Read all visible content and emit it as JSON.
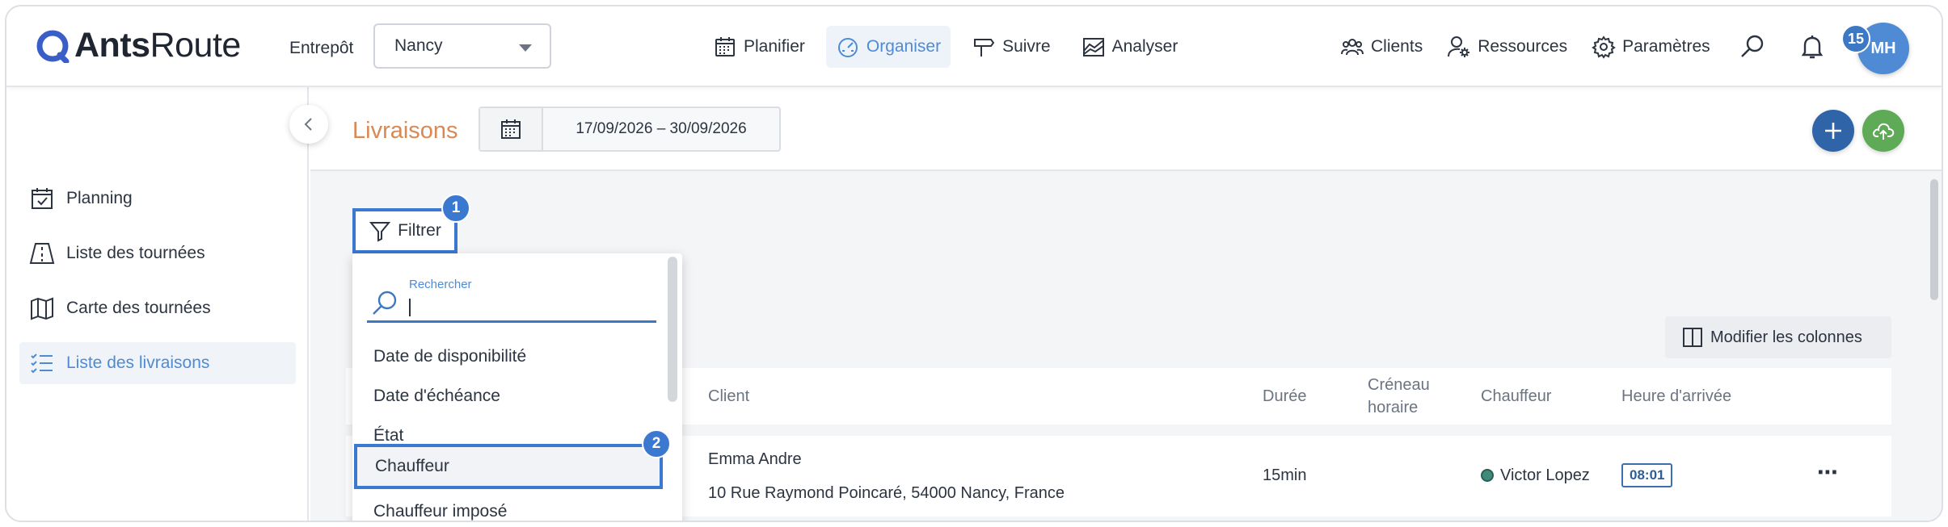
{
  "app": {
    "logo_bold": "Ants",
    "logo_light": "Route"
  },
  "topbar": {
    "entrepot_label": "Entrepôt",
    "entrepot_value": "Nancy",
    "nav": [
      {
        "label": "Planifier",
        "icon": "calendar-icon"
      },
      {
        "label": "Organiser",
        "icon": "gauge-icon",
        "active": true
      },
      {
        "label": "Suivre",
        "icon": "signpost-icon"
      },
      {
        "label": "Analyser",
        "icon": "area-chart-icon"
      }
    ],
    "right_nav": [
      {
        "label": "Clients",
        "icon": "people-icon"
      },
      {
        "label": "Ressources",
        "icon": "person-gear-icon"
      },
      {
        "label": "Paramètres",
        "icon": "gear-icon"
      }
    ],
    "notifications_count": "15",
    "avatar_initials": "MH"
  },
  "sidebar": {
    "items": [
      {
        "label": "Planning",
        "icon": "calendar-check-icon"
      },
      {
        "label": "Liste des tournées",
        "icon": "road-icon"
      },
      {
        "label": "Carte des tournées",
        "icon": "map-icon"
      },
      {
        "label": "Liste des livraisons",
        "icon": "list-check-icon",
        "active": true
      }
    ]
  },
  "header": {
    "title": "Livraisons",
    "date_range": "17/09/2026 – 30/09/2026"
  },
  "filter": {
    "button_label": "Filtrer",
    "step1": "1",
    "step2": "2",
    "search_label": "Rechercher",
    "options": [
      "Date de disponibilité",
      "Date d'échéance",
      "État",
      "Chauffeur",
      "Chauffeur imposé"
    ],
    "highlighted_option": "Chauffeur"
  },
  "table": {
    "modify_columns_label": "Modifier les colonnes",
    "columns": {
      "client": "Client",
      "duree": "Durée",
      "creneau": "Créneau horaire",
      "chauffeur": "Chauffeur",
      "arrivee": "Heure d'arrivée"
    },
    "rows": [
      {
        "client_name": "Emma Andre",
        "address": "10 Rue Raymond Poincaré, 54000 Nancy, France",
        "duree": "15min",
        "creneau": "",
        "chauffeur": "Victor Lopez",
        "arrivee": "08:01",
        "menu": "⋯"
      }
    ]
  },
  "colors": {
    "accent": "#4e8bd4",
    "highlight_border": "#3b78d0",
    "title_orange": "#d78a55",
    "add_button": "#2f64a8",
    "upload_button": "#5eaa57"
  }
}
